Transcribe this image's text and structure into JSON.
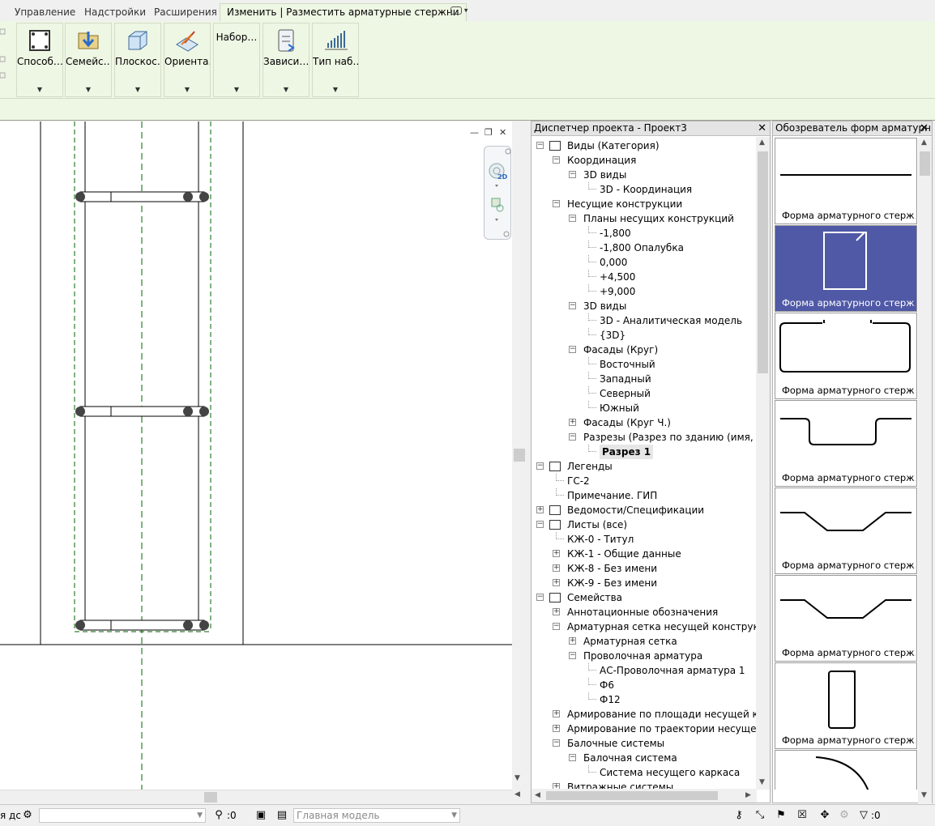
{
  "ribbon_tabs": [
    "Управление",
    "Надстройки",
    "Расширения",
    "Изменить | Разместить арматурные стержни"
  ],
  "ribbon_tab_extra": "▾",
  "ribbon_buttons": [
    {
      "label": "Способ…",
      "icon": "placement-method-icon"
    },
    {
      "label": "Семейс…",
      "icon": "family-load-icon"
    },
    {
      "label": "Плоскос…",
      "icon": "plane-icon"
    },
    {
      "label": "Ориента…",
      "icon": "orientation-icon"
    },
    {
      "label": "Набор…",
      "icon": ""
    },
    {
      "label": "Зависи…",
      "icon": "host-dependency-icon"
    },
    {
      "label": "Тип наб…",
      "icon": "rebar-set-type-icon"
    }
  ],
  "view_controls": {
    "minimize": "—",
    "restore": "❐",
    "close": "✕"
  },
  "navbar": {
    "badge": "2D"
  },
  "project_browser": {
    "title": "Диспетчер проекта - Проект3",
    "close": "✕",
    "tree": [
      {
        "label": "Виды (Категория)",
        "level": 0,
        "toggle": "−",
        "icon": "views"
      },
      {
        "label": "Координация",
        "level": 1,
        "toggle": "−"
      },
      {
        "label": "3D виды",
        "level": 2,
        "toggle": "−"
      },
      {
        "label": "3D - Координация",
        "level": 3
      },
      {
        "label": "Несущие конструкции",
        "level": 1,
        "toggle": "−"
      },
      {
        "label": "Планы несущих конструкций",
        "level": 2,
        "toggle": "−"
      },
      {
        "label": "-1,800",
        "level": 3
      },
      {
        "label": "-1,800 Опалубка",
        "level": 3
      },
      {
        "label": "0,000",
        "level": 3
      },
      {
        "label": "+4,500",
        "level": 3
      },
      {
        "label": "+9,000",
        "level": 3
      },
      {
        "label": "3D виды",
        "level": 2,
        "toggle": "−"
      },
      {
        "label": "3D - Аналитическая модель",
        "level": 3
      },
      {
        "label": "{3D}",
        "level": 3
      },
      {
        "label": "Фасады (Круг)",
        "level": 2,
        "toggle": "−"
      },
      {
        "label": "Восточный",
        "level": 3
      },
      {
        "label": "Западный",
        "level": 3
      },
      {
        "label": "Северный",
        "level": 3
      },
      {
        "label": "Южный",
        "level": 3
      },
      {
        "label": "Фасады (Круг Ч.)",
        "level": 2,
        "toggle": "+"
      },
      {
        "label": "Разрезы (Разрез по зданию (имя, номе",
        "level": 2,
        "toggle": "−"
      },
      {
        "label": "Разрез 1",
        "level": 3,
        "selected": true
      },
      {
        "label": "Легенды",
        "level": 0,
        "toggle": "−",
        "icon": "legend"
      },
      {
        "label": "ГС-2",
        "level": 1
      },
      {
        "label": "Примечание. ГИП",
        "level": 1
      },
      {
        "label": "Ведомости/Спецификации",
        "level": 0,
        "toggle": "+",
        "icon": "schedule"
      },
      {
        "label": "Листы (все)",
        "level": 0,
        "toggle": "−",
        "icon": "sheets"
      },
      {
        "label": "КЖ-0 - Титул",
        "level": 1
      },
      {
        "label": "КЖ-1 - Общие данные",
        "level": 1,
        "toggle": "+"
      },
      {
        "label": "КЖ-8 - Без имени",
        "level": 1,
        "toggle": "+"
      },
      {
        "label": "КЖ-9 - Без имени",
        "level": 1,
        "toggle": "+"
      },
      {
        "label": "Семейства",
        "level": 0,
        "toggle": "−",
        "icon": "families"
      },
      {
        "label": "Аннотационные обозначения",
        "level": 1,
        "toggle": "+"
      },
      {
        "label": "Арматурная сетка несущей конструкции",
        "level": 1,
        "toggle": "−"
      },
      {
        "label": "Арматурная сетка",
        "level": 2,
        "toggle": "+"
      },
      {
        "label": "Проволочная арматура",
        "level": 2,
        "toggle": "−"
      },
      {
        "label": "АС-Проволочная арматура 1",
        "level": 3
      },
      {
        "label": "Ф6",
        "level": 3
      },
      {
        "label": "Ф12",
        "level": 3
      },
      {
        "label": "Армирование по площади несущей конст",
        "level": 1,
        "toggle": "+"
      },
      {
        "label": "Армирование по траектории несущей ко",
        "level": 1,
        "toggle": "+"
      },
      {
        "label": "Балочные системы",
        "level": 1,
        "toggle": "−"
      },
      {
        "label": "Балочная система",
        "level": 2,
        "toggle": "−"
      },
      {
        "label": "Система несущего каркаса",
        "level": 3
      },
      {
        "label": "Витражные системы",
        "level": 1,
        "toggle": "+"
      }
    ]
  },
  "shape_browser": {
    "title": "Обозреватель форм арматурн…",
    "close": "✕",
    "shapes": [
      {
        "caption": "Форма арматурного стерж…",
        "kind": "straight",
        "active": false
      },
      {
        "caption": "Форма арматурного стерж…",
        "kind": "stirrup",
        "active": true
      },
      {
        "caption": "Форма арматурного стерж…",
        "kind": "closed-lap",
        "active": false
      },
      {
        "caption": "Форма арматурного стерж…",
        "kind": "u-bend",
        "active": false
      },
      {
        "caption": "Форма арматурного стерж…",
        "kind": "trapezoid",
        "active": false
      },
      {
        "caption": "Форма арматурного стерж…",
        "kind": "trapezoid",
        "active": false
      },
      {
        "caption": "Форма арматурного стерж…",
        "kind": "narrow-stirrup",
        "active": false
      },
      {
        "caption": "",
        "kind": "arc",
        "active": false
      }
    ]
  },
  "status_bar": {
    "left_text": "я дс",
    "filter_value": ":0",
    "workset_value": "Главная модель",
    "right_filter_value": ":0"
  }
}
